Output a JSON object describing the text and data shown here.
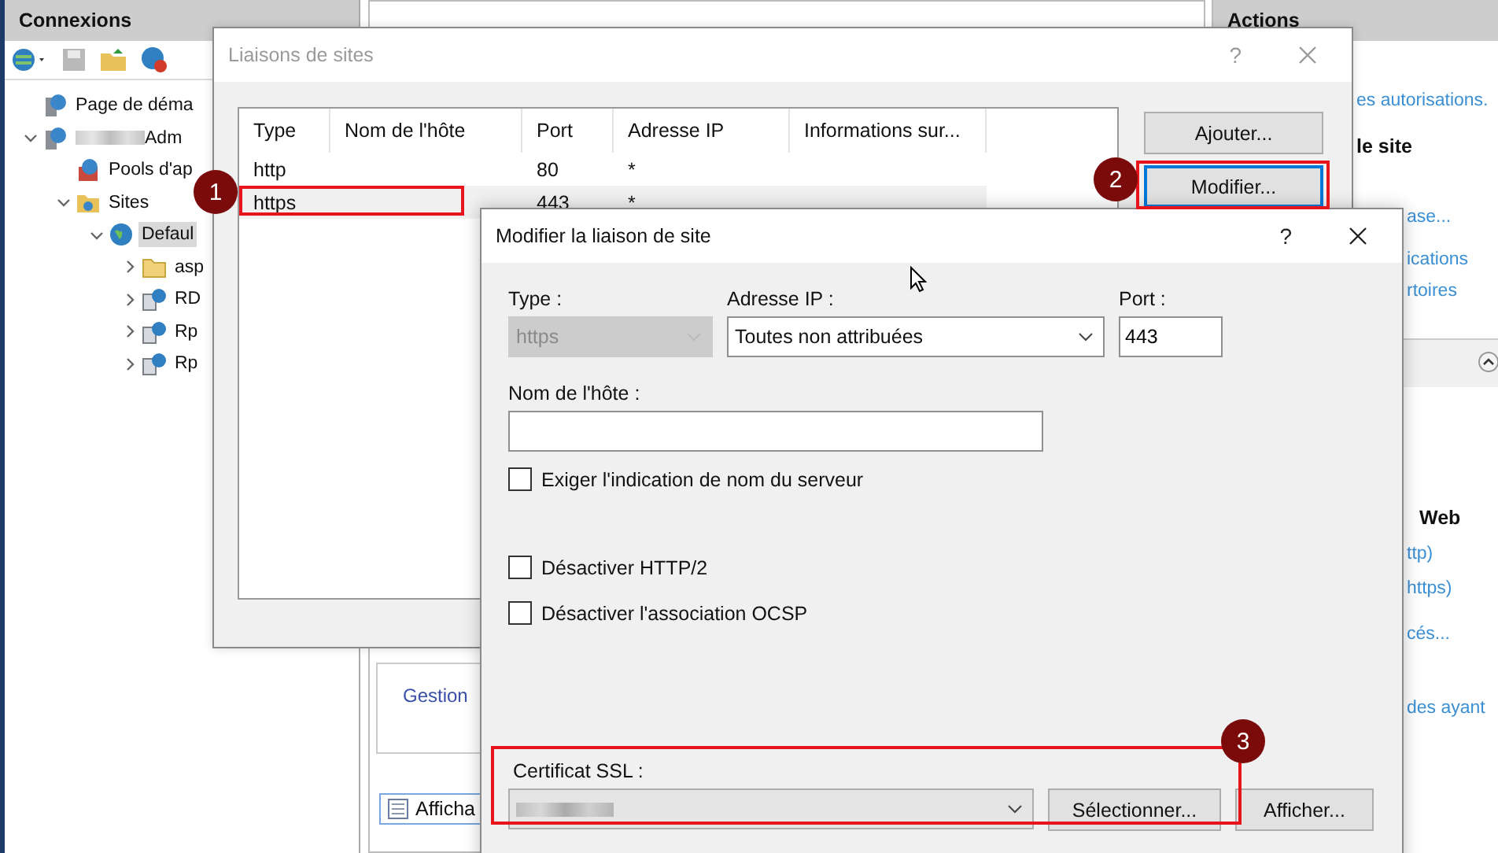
{
  "connections": {
    "title": "Connexions",
    "tree": [
      {
        "label": "Page de déma",
        "kind": "server",
        "selected": false
      },
      {
        "label": "Adm",
        "kind": "server",
        "redacted": true,
        "expanded": true,
        "selected": false,
        "children": [
          {
            "label": "Pools d'ap",
            "kind": "pool",
            "selected": false
          },
          {
            "label": "Sites",
            "kind": "sites",
            "expanded": true,
            "selected": false,
            "children": [
              {
                "label": "Defaul",
                "kind": "globe",
                "expanded": true,
                "selected": true,
                "children": [
                  {
                    "label": "asp",
                    "kind": "folder",
                    "expanded": false,
                    "selected": false
                  },
                  {
                    "label": "RD",
                    "kind": "app",
                    "expanded": false,
                    "selected": false
                  },
                  {
                    "label": "Rp",
                    "kind": "app",
                    "expanded": false,
                    "selected": false
                  },
                  {
                    "label": "Rp",
                    "kind": "app",
                    "expanded": false,
                    "selected": false
                  }
                ]
              }
            ]
          }
        ]
      }
    ]
  },
  "center": {
    "link": "Gestion",
    "view_tab": "Afficha"
  },
  "actions": {
    "title": "Actions",
    "items": [
      {
        "kind": "link",
        "text": "es autorisations."
      },
      {
        "kind": "heading",
        "text": "le site"
      },
      {
        "kind": "link",
        "text": "ase..."
      },
      {
        "kind": "link",
        "text": "ications"
      },
      {
        "kind": "link",
        "text": "rtoires"
      },
      {
        "kind": "heading",
        "text": "Web"
      },
      {
        "kind": "link",
        "text": "ttp)"
      },
      {
        "kind": "link",
        "text": "https)"
      },
      {
        "kind": "link",
        "text": "cés..."
      },
      {
        "kind": "link",
        "text": "des ayant"
      }
    ]
  },
  "bindings_dialog": {
    "title": "Liaisons de sites",
    "help": "?",
    "columns": [
      "Type",
      "Nom de l'hôte",
      "Port",
      "Adresse IP",
      "Informations sur..."
    ],
    "rows": [
      {
        "type": "http",
        "port": "80",
        "ip": "*",
        "selected": false
      },
      {
        "type": "https",
        "port": "443",
        "ip": "*",
        "selected": true
      }
    ],
    "buttons": [
      {
        "label": "Ajouter...",
        "focused": false
      },
      {
        "label": "Modifier...",
        "focused": true
      }
    ]
  },
  "edit_dialog": {
    "title": "Modifier la liaison de site",
    "help": "?",
    "type": {
      "label": "Type :",
      "value": "https",
      "disabled": true
    },
    "ip": {
      "label": "Adresse IP :",
      "value": "Toutes non attribuées"
    },
    "port": {
      "label": "Port :",
      "value": "443"
    },
    "hostname": {
      "label": "Nom de l'hôte :"
    },
    "options": [
      {
        "label": "Exiger l'indication de nom du serveur",
        "checked": false
      },
      {
        "label": "Désactiver HTTP/2",
        "checked": false
      },
      {
        "label": "Désactiver l'association OCSP",
        "checked": false
      }
    ],
    "certificate": {
      "label": "Certificat SSL :",
      "redacted": true
    },
    "cert_buttons": [
      "Sélectionner...",
      "Afficher..."
    ]
  },
  "callouts": [
    {
      "number": "1"
    },
    {
      "number": "2"
    },
    {
      "number": "3"
    }
  ]
}
